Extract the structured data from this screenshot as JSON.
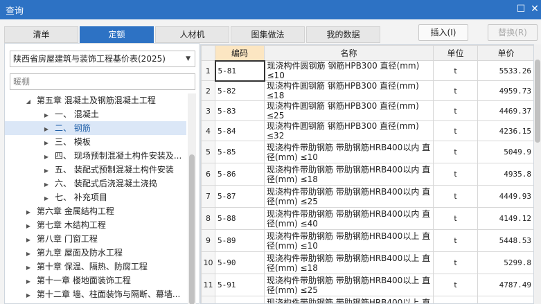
{
  "window": {
    "title": "查询",
    "maximize_icon": "maximize-icon",
    "close_icon": "close-icon"
  },
  "tabs": [
    "清单",
    "定额",
    "人材机",
    "图集做法",
    "我的数据"
  ],
  "active_tab": "定额",
  "buttons": {
    "insert": "插入(I)",
    "replace": "替换(R)"
  },
  "left": {
    "quota_library": "陕西省房屋建筑与装饰工程基价表(2025)",
    "search_value": "暖棚",
    "tree": [
      {
        "text": "第五章  混凝土及钢筋混凝土工程",
        "level": 1,
        "expanded": true,
        "selected": false
      },
      {
        "text": "一、 混凝土",
        "level": 2,
        "expanded": false,
        "selected": false
      },
      {
        "text": "二、 钢筋",
        "level": 2,
        "expanded": false,
        "selected": true
      },
      {
        "text": "三、 模板",
        "level": 2,
        "expanded": false,
        "selected": false
      },
      {
        "text": "四、 现场预制混凝土构件安装及...",
        "level": 2,
        "expanded": false,
        "selected": false
      },
      {
        "text": "五、 装配式预制混凝土构件安装",
        "level": 2,
        "expanded": false,
        "selected": false
      },
      {
        "text": "六、 装配式后浇混凝土浇捣",
        "level": 2,
        "expanded": false,
        "selected": false
      },
      {
        "text": "七、 补充项目",
        "level": 2,
        "expanded": false,
        "selected": false
      },
      {
        "text": "第六章 金属结构工程",
        "level": 1,
        "expanded": false,
        "selected": false
      },
      {
        "text": "第七章 木结构工程",
        "level": 1,
        "expanded": false,
        "selected": false
      },
      {
        "text": "第八章 门窗工程",
        "level": 1,
        "expanded": false,
        "selected": false
      },
      {
        "text": "第九章 屋面及防水工程",
        "level": 1,
        "expanded": false,
        "selected": false
      },
      {
        "text": "第十章 保温、隔热、防腐工程",
        "level": 1,
        "expanded": false,
        "selected": false
      },
      {
        "text": "第十一章 楼地面装饰工程",
        "level": 1,
        "expanded": false,
        "selected": false
      },
      {
        "text": "第十二章 墙、柱面装饰与隔断、幕墙...",
        "level": 1,
        "expanded": false,
        "selected": false
      }
    ]
  },
  "grid": {
    "columns": {
      "code": "编码",
      "name": "名称",
      "unit": "单位",
      "price": "单价"
    },
    "rows": [
      {
        "idx": "1",
        "code": "5-81",
        "name": "现浇构件圆钢筋 钢筋HPB300 直径(mm) ≤10",
        "unit": "t",
        "price": "5533.26"
      },
      {
        "idx": "2",
        "code": "5-82",
        "name": "现浇构件圆钢筋 钢筋HPB300 直径(mm) ≤18",
        "unit": "t",
        "price": "4959.73"
      },
      {
        "idx": "3",
        "code": "5-83",
        "name": "现浇构件圆钢筋 钢筋HPB300 直径(mm) ≤25",
        "unit": "t",
        "price": "4469.37"
      },
      {
        "idx": "4",
        "code": "5-84",
        "name": "现浇构件圆钢筋 钢筋HPB300 直径(mm) ≤32",
        "unit": "t",
        "price": "4236.15"
      },
      {
        "idx": "5",
        "code": "5-85",
        "name": "现浇构件带肋钢筋 带肋钢筋HRB400以内 直径(mm) ≤10",
        "unit": "t",
        "price": "5049.9"
      },
      {
        "idx": "6",
        "code": "5-86",
        "name": "现浇构件带肋钢筋 带肋钢筋HRB400以内 直径(mm) ≤18",
        "unit": "t",
        "price": "4935.8"
      },
      {
        "idx": "7",
        "code": "5-87",
        "name": "现浇构件带肋钢筋 带肋钢筋HRB400以内 直径(mm) ≤25",
        "unit": "t",
        "price": "4449.93"
      },
      {
        "idx": "8",
        "code": "5-88",
        "name": "现浇构件带肋钢筋 带肋钢筋HRB400以内 直径(mm) ≤40",
        "unit": "t",
        "price": "4149.12"
      },
      {
        "idx": "9",
        "code": "5-89",
        "name": "现浇构件带肋钢筋 带肋钢筋HRB400以上 直径(mm) ≤10",
        "unit": "t",
        "price": "5448.53"
      },
      {
        "idx": "10",
        "code": "5-90",
        "name": "现浇构件带肋钢筋 带肋钢筋HRB400以上 直径(mm) ≤18",
        "unit": "t",
        "price": "5299.8"
      },
      {
        "idx": "11",
        "code": "5-91",
        "name": "现浇构件带肋钢筋 带肋钢筋HRB400以上 直径(mm) ≤25",
        "unit": "t",
        "price": "4787.49"
      },
      {
        "idx": "12",
        "code": "5-92",
        "name": "现浇构件带肋钢筋 带肋钢筋HRB400以上 直径(mm) ≤40",
        "unit": "t",
        "price": "4461.76"
      }
    ]
  },
  "colors": {
    "accent": "#2d72c4",
    "sorted_header": "#fce6c2",
    "selected_row": "#dbe7f7"
  }
}
